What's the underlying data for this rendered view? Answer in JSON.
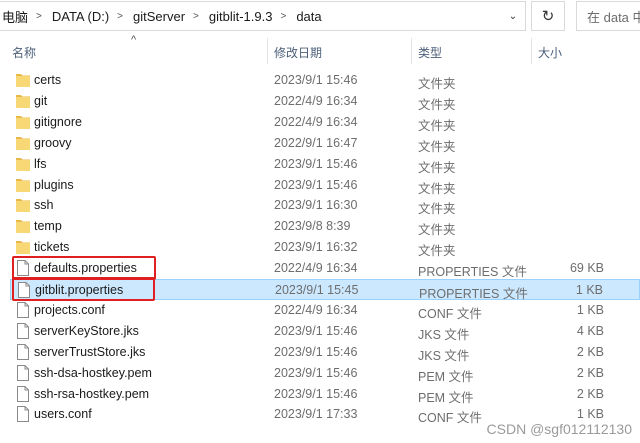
{
  "address": {
    "crumbs": [
      "电脑",
      "DATA (D:)",
      "gitServer",
      "gitblit-1.9.3",
      "data"
    ],
    "dropdown_glyph": "⌄",
    "refresh_glyph": "↻",
    "search_placeholder": "在 data 中搜"
  },
  "columns": {
    "name": "名称",
    "date": "修改日期",
    "type": "类型",
    "size": "大小",
    "sort_glyph": "^"
  },
  "files": [
    {
      "name": "certs",
      "date": "2023/9/1 15:46",
      "type": "文件夹",
      "size": "",
      "kind": "folder"
    },
    {
      "name": "git",
      "date": "2022/4/9 16:34",
      "type": "文件夹",
      "size": "",
      "kind": "folder"
    },
    {
      "name": "gitignore",
      "date": "2022/4/9 16:34",
      "type": "文件夹",
      "size": "",
      "kind": "folder"
    },
    {
      "name": "groovy",
      "date": "2022/9/1 16:47",
      "type": "文件夹",
      "size": "",
      "kind": "folder"
    },
    {
      "name": "lfs",
      "date": "2023/9/1 15:46",
      "type": "文件夹",
      "size": "",
      "kind": "folder"
    },
    {
      "name": "plugins",
      "date": "2023/9/1 15:46",
      "type": "文件夹",
      "size": "",
      "kind": "folder"
    },
    {
      "name": "ssh",
      "date": "2023/9/1 16:30",
      "type": "文件夹",
      "size": "",
      "kind": "folder"
    },
    {
      "name": "temp",
      "date": "2023/9/8 8:39",
      "type": "文件夹",
      "size": "",
      "kind": "folder"
    },
    {
      "name": "tickets",
      "date": "2023/9/1 16:32",
      "type": "文件夹",
      "size": "",
      "kind": "folder"
    },
    {
      "name": "defaults.properties",
      "date": "2022/4/9 16:34",
      "type": "PROPERTIES 文件",
      "size": "69 KB",
      "kind": "file"
    },
    {
      "name": "gitblit.properties",
      "date": "2023/9/1 15:45",
      "type": "PROPERTIES 文件",
      "size": "1 KB",
      "kind": "file",
      "selected": true
    },
    {
      "name": "projects.conf",
      "date": "2022/4/9 16:34",
      "type": "CONF 文件",
      "size": "1 KB",
      "kind": "file"
    },
    {
      "name": "serverKeyStore.jks",
      "date": "2023/9/1 15:46",
      "type": "JKS 文件",
      "size": "4 KB",
      "kind": "file"
    },
    {
      "name": "serverTrustStore.jks",
      "date": "2023/9/1 15:46",
      "type": "JKS 文件",
      "size": "2 KB",
      "kind": "file"
    },
    {
      "name": "ssh-dsa-hostkey.pem",
      "date": "2023/9/1 15:46",
      "type": "PEM 文件",
      "size": "2 KB",
      "kind": "file"
    },
    {
      "name": "ssh-rsa-hostkey.pem",
      "date": "2023/9/1 15:46",
      "type": "PEM 文件",
      "size": "2 KB",
      "kind": "file"
    },
    {
      "name": "users.conf",
      "date": "2023/9/1 17:33",
      "type": "CONF 文件",
      "size": "1 KB",
      "kind": "file"
    }
  ],
  "colors": {
    "folder": "#f8d775",
    "folder_dark": "#e8b84a",
    "selection": "#cce8ff",
    "highlight_box": "#e02020"
  },
  "watermark": "CSDN @sgf012112130"
}
